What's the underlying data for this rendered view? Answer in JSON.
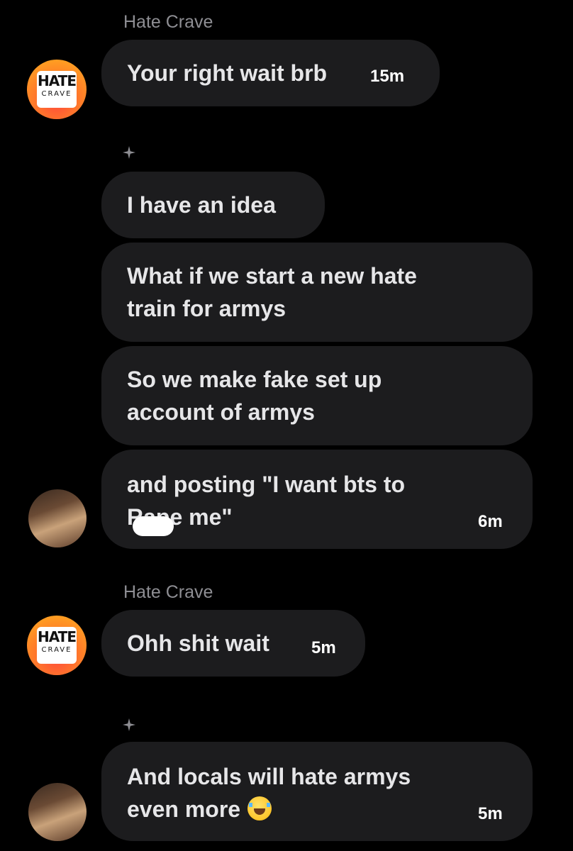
{
  "thread": {
    "messages": [
      {
        "sender": "Hate Crave",
        "text": "Your right wait brb",
        "time": "15m"
      },
      {
        "text": "I have an idea"
      },
      {
        "text": "What if we start a new hate\ntrain for armys"
      },
      {
        "text": "So we make fake set up\naccount of armys"
      },
      {
        "text": "and posting \"I want bts to\nRape me\"",
        "time": "6m"
      },
      {
        "sender": "Hate Crave",
        "text": "Ohh shit wait",
        "time": "5m"
      },
      {
        "text": "And locals will hate armys\neven more",
        "emoji": "face-with-tears-of-joy",
        "time": "5m"
      }
    ]
  },
  "avatars": {
    "hate_crave_logo": {
      "top": "HATE",
      "bottom": "CRAVE"
    }
  },
  "colors": {
    "background": "#000000",
    "bubble": "#1c1c1e",
    "sender_name": "#8e8e93"
  }
}
